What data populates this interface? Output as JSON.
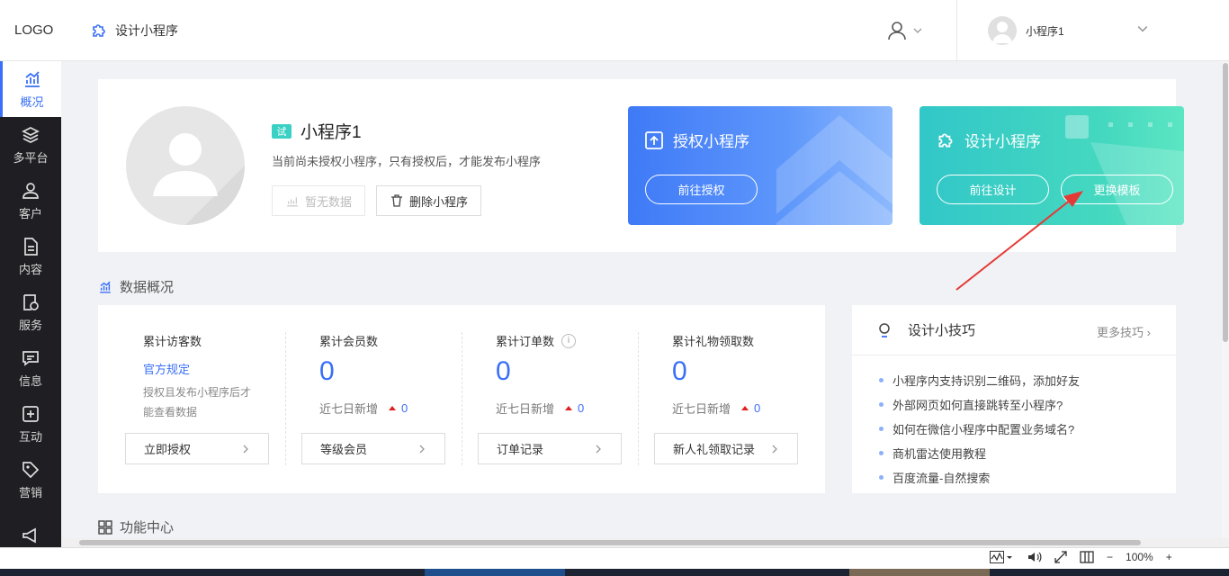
{
  "header": {
    "logo": "LOGO",
    "app_title": "设计小程序",
    "account_name": "小程序1"
  },
  "sidebar": {
    "items": [
      {
        "label": "概况",
        "icon": "chart-icon",
        "active": true
      },
      {
        "label": "多平台",
        "icon": "layers-icon"
      },
      {
        "label": "客户",
        "icon": "user-icon"
      },
      {
        "label": "内容",
        "icon": "document-icon"
      },
      {
        "label": "服务",
        "icon": "service-icon"
      },
      {
        "label": "信息",
        "icon": "message-icon"
      },
      {
        "label": "互动",
        "icon": "interaction-icon"
      },
      {
        "label": "营销",
        "icon": "tag-icon"
      },
      {
        "label": "",
        "icon": "megaphone-icon"
      }
    ]
  },
  "profile": {
    "badge": "试",
    "name": "小程序1",
    "desc": "当前尚未授权小程序，只有授权后，才能发布小程序",
    "btn_no_data": "暂无数据",
    "btn_delete": "删除小程序"
  },
  "promo_auth": {
    "title": "授权小程序",
    "button": "前往授权"
  },
  "promo_design": {
    "title": "设计小程序",
    "button_design": "前往设计",
    "button_template": "更换模板"
  },
  "data_overview": {
    "title": "数据概况",
    "stats": [
      {
        "label": "累计访客数",
        "link": "官方规定",
        "note": "授权且发布小程序后才能查看数据",
        "button": "立即授权"
      },
      {
        "label": "累计会员数",
        "value": "0",
        "sub_label": "近七日新增",
        "sub_value": "0",
        "button": "等级会员"
      },
      {
        "label": "累计订单数",
        "info": "i",
        "value": "0",
        "sub_label": "近七日新增",
        "sub_value": "0",
        "button": "订单记录"
      },
      {
        "label": "累计礼物领取数",
        "value": "0",
        "sub_label": "近七日新增",
        "sub_value": "0",
        "button": "新人礼领取记录"
      }
    ]
  },
  "tips": {
    "title": "设计小技巧",
    "more": "更多技巧",
    "items": [
      "小程序内支持识别二维码，添加好友",
      "外部网页如何直接跳转至小程序?",
      "如何在微信小程序中配置业务域名?",
      "商机雷达使用教程",
      "百度流量-自然搜索"
    ]
  },
  "function_center": {
    "title": "功能中心"
  },
  "statusbar": {
    "zoom": "100%"
  },
  "colors": {
    "accent": "#3a6ff7",
    "sidebar_bg": "#1e1e23",
    "annotation_arrow": "#e53935"
  }
}
